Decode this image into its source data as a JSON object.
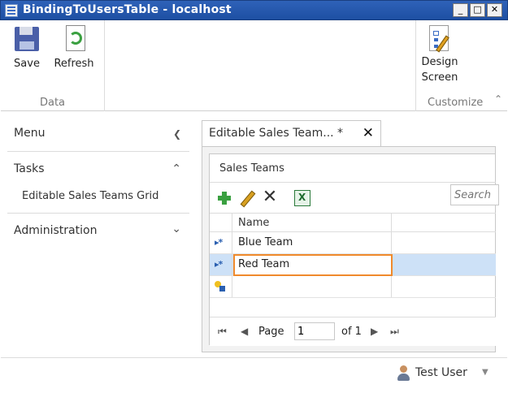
{
  "window": {
    "title": "BindingToUsersTable - localhost",
    "min": "_",
    "max": "□",
    "close": "✕"
  },
  "ribbon": {
    "data_group": {
      "label": "Data",
      "save_label": "Save",
      "refresh_label": "Refresh"
    },
    "customize_group": {
      "label": "Customize",
      "design_label_1": "Design",
      "design_label_2": "Screen",
      "collapse_glyph": "⌃"
    }
  },
  "nav": {
    "menu_label": "Menu",
    "menu_chevron": "❮",
    "tasks_label": "Tasks",
    "tasks_chevron": "⌃",
    "tasks_item": "Editable Sales Teams Grid",
    "admin_label": "Administration",
    "admin_chevron": "⌄"
  },
  "tab": {
    "label": "Editable Sales Team... *",
    "close_glyph": "✕"
  },
  "screen": {
    "section_title": "Sales Teams",
    "search_placeholder": "Search",
    "delete_glyph": "✕",
    "grid": {
      "header": "Name",
      "row_indicator": "▸*",
      "rows": [
        "Blue Team",
        "Red Team"
      ]
    },
    "pager": {
      "first": "⏮",
      "prev": "◀",
      "page_label": "Page",
      "page_value": "1",
      "of_label": "of 1",
      "next": "▶",
      "last": "⏭"
    }
  },
  "status": {
    "user": "Test User",
    "caret": "▼"
  }
}
